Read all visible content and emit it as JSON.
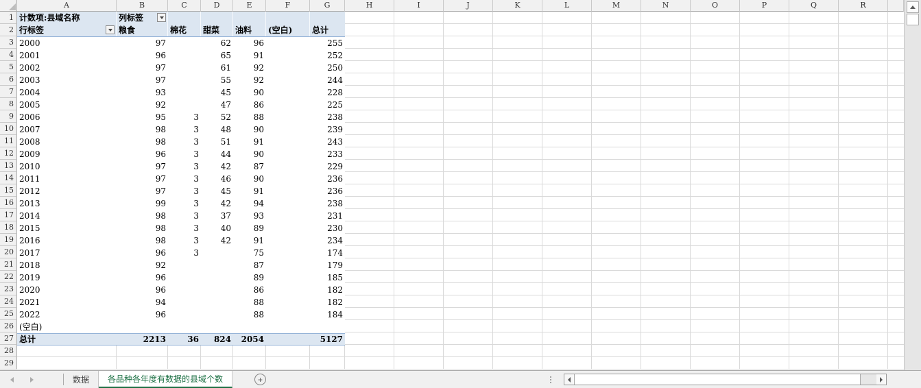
{
  "colors": {
    "pivot_header_bg": "#DCE6F1",
    "pivot_border": "#95B3D7",
    "active_tab_green": "#1E7145",
    "gridline": "#D9D9D9",
    "header_bg": "#F1F1F1"
  },
  "grid": {
    "column_letters": [
      "A",
      "B",
      "C",
      "D",
      "E",
      "F",
      "G",
      "H",
      "I",
      "J",
      "K",
      "L",
      "M",
      "N",
      "O",
      "P",
      "Q",
      "R"
    ],
    "row_numbers": [
      "1",
      "2",
      "3",
      "4",
      "5",
      "6",
      "7",
      "8",
      "9",
      "10",
      "11",
      "12",
      "13",
      "14",
      "15",
      "16",
      "17",
      "18",
      "19",
      "20",
      "21",
      "22",
      "23",
      "24",
      "25",
      "26",
      "27",
      "28",
      "29"
    ]
  },
  "pivot": {
    "measure_label": "计数项:县域名称",
    "column_labels_caption": "列标签",
    "row_labels_caption": "行标签",
    "columns": [
      "粮食",
      "棉花",
      "甜菜",
      "油料",
      "(空白)",
      "总计"
    ],
    "rows": [
      {
        "label": "2000",
        "values": [
          "97",
          "",
          "62",
          "96",
          "",
          "255"
        ]
      },
      {
        "label": "2001",
        "values": [
          "96",
          "",
          "65",
          "91",
          "",
          "252"
        ]
      },
      {
        "label": "2002",
        "values": [
          "97",
          "",
          "61",
          "92",
          "",
          "250"
        ]
      },
      {
        "label": "2003",
        "values": [
          "97",
          "",
          "55",
          "92",
          "",
          "244"
        ]
      },
      {
        "label": "2004",
        "values": [
          "93",
          "",
          "45",
          "90",
          "",
          "228"
        ]
      },
      {
        "label": "2005",
        "values": [
          "92",
          "",
          "47",
          "86",
          "",
          "225"
        ]
      },
      {
        "label": "2006",
        "values": [
          "95",
          "3",
          "52",
          "88",
          "",
          "238"
        ]
      },
      {
        "label": "2007",
        "values": [
          "98",
          "3",
          "48",
          "90",
          "",
          "239"
        ]
      },
      {
        "label": "2008",
        "values": [
          "98",
          "3",
          "51",
          "91",
          "",
          "243"
        ]
      },
      {
        "label": "2009",
        "values": [
          "96",
          "3",
          "44",
          "90",
          "",
          "233"
        ]
      },
      {
        "label": "2010",
        "values": [
          "97",
          "3",
          "42",
          "87",
          "",
          "229"
        ]
      },
      {
        "label": "2011",
        "values": [
          "97",
          "3",
          "46",
          "90",
          "",
          "236"
        ]
      },
      {
        "label": "2012",
        "values": [
          "97",
          "3",
          "45",
          "91",
          "",
          "236"
        ]
      },
      {
        "label": "2013",
        "values": [
          "99",
          "3",
          "42",
          "94",
          "",
          "238"
        ]
      },
      {
        "label": "2014",
        "values": [
          "98",
          "3",
          "37",
          "93",
          "",
          "231"
        ]
      },
      {
        "label": "2015",
        "values": [
          "98",
          "3",
          "40",
          "89",
          "",
          "230"
        ]
      },
      {
        "label": "2016",
        "values": [
          "98",
          "3",
          "42",
          "91",
          "",
          "234"
        ]
      },
      {
        "label": "2017",
        "values": [
          "96",
          "3",
          "",
          "75",
          "",
          "174"
        ]
      },
      {
        "label": "2018",
        "values": [
          "92",
          "",
          "",
          "87",
          "",
          "179"
        ]
      },
      {
        "label": "2019",
        "values": [
          "96",
          "",
          "",
          "89",
          "",
          "185"
        ]
      },
      {
        "label": "2020",
        "values": [
          "96",
          "",
          "",
          "86",
          "",
          "182"
        ]
      },
      {
        "label": "2021",
        "values": [
          "94",
          "",
          "",
          "88",
          "",
          "182"
        ]
      },
      {
        "label": "2022",
        "values": [
          "96",
          "",
          "",
          "88",
          "",
          "184"
        ]
      },
      {
        "label": "(空白)",
        "values": [
          "",
          "",
          "",
          "",
          "",
          ""
        ]
      }
    ],
    "grand_total": {
      "label": "总计",
      "values": [
        "2213",
        "36",
        "824",
        "2054",
        "",
        "5127"
      ]
    }
  },
  "tab_bar": {
    "tabs": [
      {
        "label": "数据",
        "active": false
      },
      {
        "label": "各品种各年度有数据的县域个数",
        "active": true
      }
    ],
    "add_sheet_label": "+"
  },
  "icons": {
    "filter_dropdown": "▼",
    "select_all_corner": "◢",
    "scroll_up": "▲",
    "scroll_left": "◀",
    "scroll_right": "▶",
    "nav_prev_sheet": "◀",
    "nav_next_sheet": "▶",
    "new_sheet": "+"
  }
}
